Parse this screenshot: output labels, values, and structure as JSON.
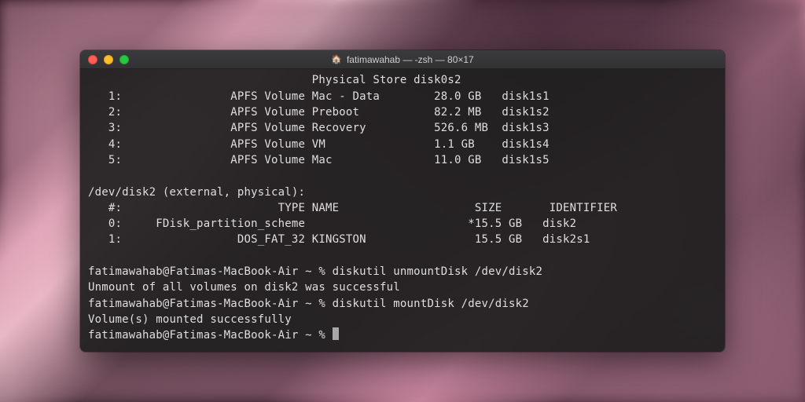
{
  "window": {
    "title": "fatimawahab — -zsh — 80×17"
  },
  "terminal": {
    "physical_store_header": "                                 Physical Store disk0s2",
    "disk1_rows": [
      {
        "idx": "   1:",
        "type": "                APFS Volume Mac - Data",
        "size": "        28.0 GB",
        "id": "   disk1s1"
      },
      {
        "idx": "   2:",
        "type": "                APFS Volume Preboot",
        "size": "           82.2 MB",
        "id": "   disk1s2"
      },
      {
        "idx": "   3:",
        "type": "                APFS Volume Recovery",
        "size": "          526.6 MB",
        "id": "  disk1s3"
      },
      {
        "idx": "   4:",
        "type": "                APFS Volume VM",
        "size": "                1.1 GB",
        "id": "    disk1s4"
      },
      {
        "idx": "   5:",
        "type": "                APFS Volume Mac",
        "size": "               11.0 GB",
        "id": "   disk1s5"
      }
    ],
    "disk2_header": "/dev/disk2 (external, physical):",
    "disk2_col_header": "   #:                       TYPE NAME                    SIZE       IDENTIFIER",
    "disk2_rows": [
      {
        "line": "   0:     FDisk_partition_scheme                        *15.5 GB   disk2"
      },
      {
        "line": "   1:                 DOS_FAT_32 KINGSTON                15.5 GB   disk2s1"
      }
    ],
    "cmds": [
      {
        "prompt": "fatimawahab@Fatimas-MacBook-Air ~ % ",
        "cmd": "diskutil unmountDisk /dev/disk2"
      },
      {
        "output": "Unmount of all volumes on disk2 was successful"
      },
      {
        "prompt": "fatimawahab@Fatimas-MacBook-Air ~ % ",
        "cmd": "diskutil mountDisk /dev/disk2"
      },
      {
        "output": "Volume(s) mounted successfully"
      }
    ],
    "final_prompt": "fatimawahab@Fatimas-MacBook-Air ~ % "
  }
}
